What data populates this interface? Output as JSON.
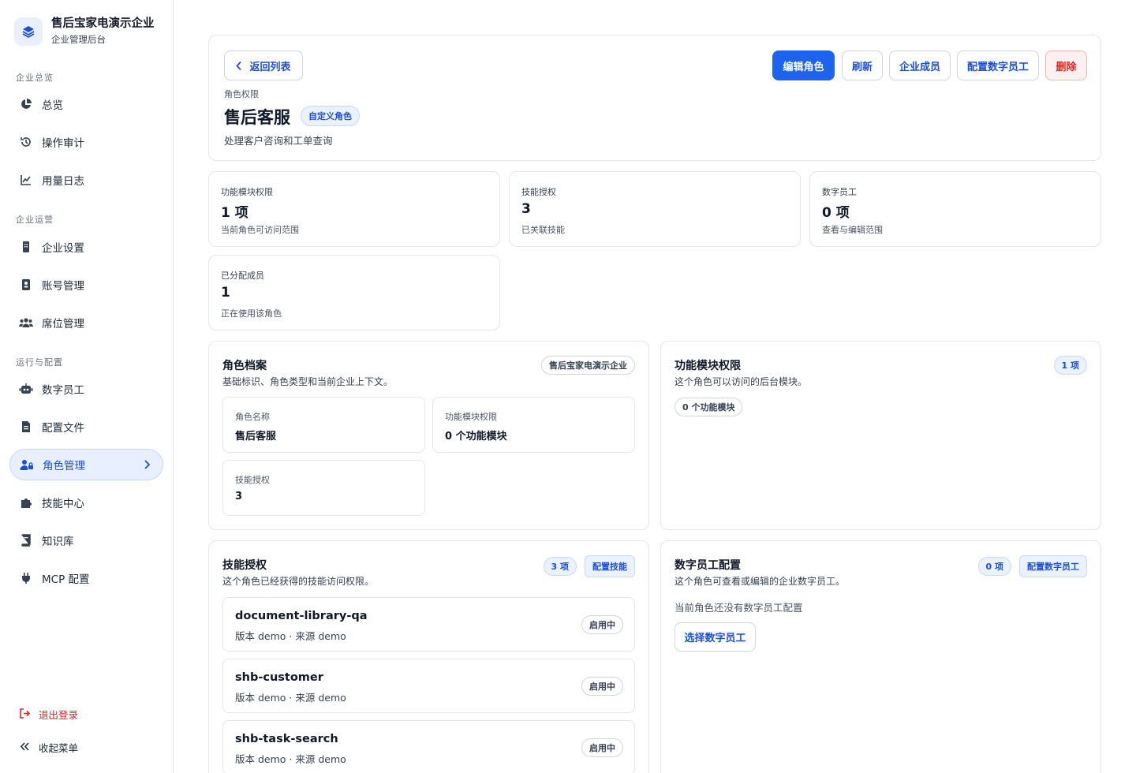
{
  "sidebar": {
    "brand_name": "售后宝家电演示企业",
    "brand_sub": "企业管理后台",
    "sections": [
      "企业总览",
      "企业运营",
      "运行与配置"
    ],
    "items": [
      {
        "label": "总览",
        "icon": "pie-chart-icon"
      },
      {
        "label": "操作审计",
        "icon": "history-icon"
      },
      {
        "label": "用量日志",
        "icon": "line-chart-icon"
      },
      {
        "label": "企业设置",
        "icon": "building-icon"
      },
      {
        "label": "账号管理",
        "icon": "id-badge-icon"
      },
      {
        "label": "席位管理",
        "icon": "users-icon"
      },
      {
        "label": "数字员工",
        "icon": "robot-icon"
      },
      {
        "label": "配置文件",
        "icon": "file-icon"
      },
      {
        "label": "角色管理",
        "icon": "user-lock-icon"
      },
      {
        "label": "技能中心",
        "icon": "puzzle-icon"
      },
      {
        "label": "知识库",
        "icon": "book-icon"
      },
      {
        "label": "MCP 配置",
        "icon": "plug-icon"
      }
    ],
    "logout": "退出登录",
    "collapse": "收起菜单"
  },
  "header": {
    "back": "返回列表",
    "eyebrow": "角色权限",
    "title": "售后客服",
    "badge": "自定义角色",
    "desc": "处理客户咨询和工单查询",
    "actions": [
      "编辑角色",
      "刷新",
      "企业成员",
      "配置数字员工",
      "删除"
    ]
  },
  "stats": [
    {
      "label": "功能模块权限",
      "value": "1 项",
      "sub": "当前角色可访问范围"
    },
    {
      "label": "技能授权",
      "value": "3",
      "sub": "已关联技能"
    },
    {
      "label": "数字员工",
      "value": "0 项",
      "sub": "查看与编辑范围"
    },
    {
      "label": "已分配成员",
      "value": "1",
      "sub": "正在使用该角色"
    }
  ],
  "profile": {
    "title": "角色档案",
    "sub": "基础标识、角色类型和当前企业上下文。",
    "tag": "售后宝家电演示企业",
    "fields": [
      {
        "label": "角色名称",
        "value": "售后客服"
      },
      {
        "label": "功能模块权限",
        "value": "0 个功能模块"
      },
      {
        "label": "技能授权",
        "value": "3"
      }
    ]
  },
  "modules": {
    "title": "功能模块权限",
    "sub": "这个角色可以访问的后台模块。",
    "count": "1 项",
    "chip": "0 个功能模块"
  },
  "skills": {
    "title": "技能授权",
    "sub": "这个角色已经获得的技能访问权限。",
    "count": "3 项",
    "config": "配置技能",
    "items": [
      {
        "name": "document-library-qa",
        "meta": "版本 demo  ·  来源 demo",
        "status": "启用中"
      },
      {
        "name": "shb-customer",
        "meta": "版本 demo  ·  来源 demo",
        "status": "启用中"
      },
      {
        "name": "shb-task-search",
        "meta": "版本 demo  ·  来源 demo",
        "status": "启用中"
      }
    ]
  },
  "employees": {
    "title": "数字员工配置",
    "sub": "这个角色可查看或编辑的企业数字员工。",
    "count": "0 项",
    "config": "配置数字员工",
    "empty": "当前角色还没有数字员工配置",
    "select": "选择数字员工"
  },
  "colors": {
    "accent": "#1d63ed",
    "danger": "#dc2626",
    "active_bg": "#e8efff"
  }
}
